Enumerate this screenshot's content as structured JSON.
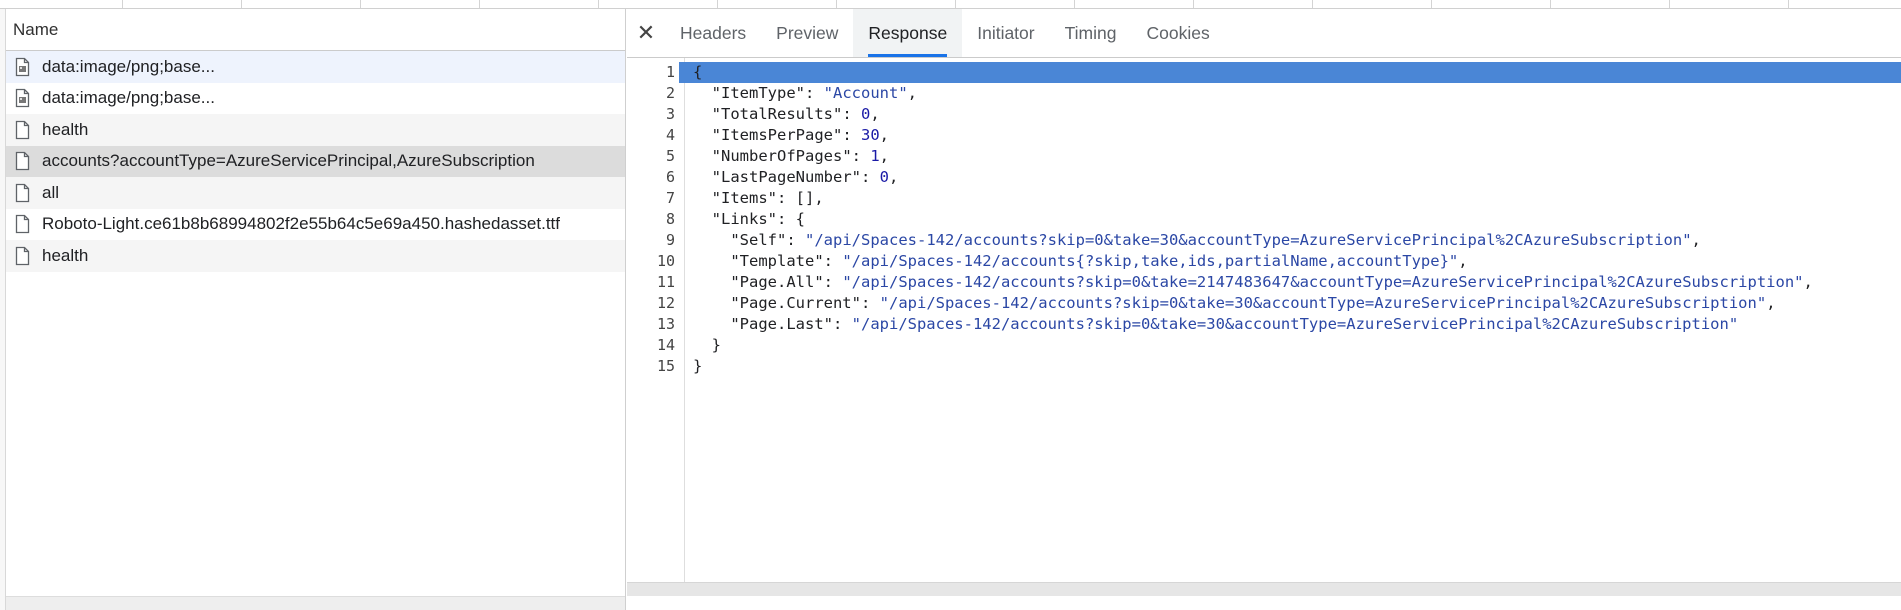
{
  "list": {
    "header": "Name",
    "rows": [
      {
        "name": "data:image/png;base...",
        "icon": "image-file-icon"
      },
      {
        "name": "data:image/png;base...",
        "icon": "image-file-icon"
      },
      {
        "name": "health",
        "icon": "document-icon"
      },
      {
        "name": "accounts?accountType=AzureServicePrincipal,AzureSubscription",
        "icon": "document-icon"
      },
      {
        "name": "all",
        "icon": "document-icon"
      },
      {
        "name": "Roboto-Light.ce61b8b68994802f2e55b64c5e69a450.hashedasset.ttf",
        "icon": "document-icon"
      },
      {
        "name": "health",
        "icon": "document-icon"
      }
    ]
  },
  "tabs": {
    "close": "✕",
    "items": [
      "Headers",
      "Preview",
      "Response",
      "Initiator",
      "Timing",
      "Cookies"
    ],
    "active": "Response"
  },
  "response": {
    "lines": [
      {
        "n": "1",
        "text": "{"
      },
      {
        "n": "2",
        "text": "  \"ItemType\": \"Account\","
      },
      {
        "n": "3",
        "text": "  \"TotalResults\": 0,"
      },
      {
        "n": "4",
        "text": "  \"ItemsPerPage\": 30,"
      },
      {
        "n": "5",
        "text": "  \"NumberOfPages\": 1,"
      },
      {
        "n": "6",
        "text": "  \"LastPageNumber\": 0,"
      },
      {
        "n": "7",
        "text": "  \"Items\": [],"
      },
      {
        "n": "8",
        "text": "  \"Links\": {"
      },
      {
        "n": "9",
        "text": "    \"Self\": \"/api/Spaces-142/accounts?skip=0&take=30&accountType=AzureServicePrincipal%2CAzureSubscription\","
      },
      {
        "n": "10",
        "text": "    \"Template\": \"/api/Spaces-142/accounts{?skip,take,ids,partialName,accountType}\","
      },
      {
        "n": "11",
        "text": "    \"Page.All\": \"/api/Spaces-142/accounts?skip=0&take=2147483647&accountType=AzureServicePrincipal%2CAzureSubscription\","
      },
      {
        "n": "12",
        "text": "    \"Page.Current\": \"/api/Spaces-142/accounts?skip=0&take=30&accountType=AzureServicePrincipal%2CAzureSubscription\","
      },
      {
        "n": "13",
        "text": "    \"Page.Last\": \"/api/Spaces-142/accounts?skip=0&take=30&accountType=AzureServicePrincipal%2CAzureSubscription\""
      },
      {
        "n": "14",
        "text": "  }"
      },
      {
        "n": "15",
        "text": "}"
      }
    ]
  },
  "colors": {
    "highlight": "#4a86d6",
    "active_tab_underline": "#1a73e8",
    "string": "#2b47a5",
    "number": "#1a1aa6"
  }
}
